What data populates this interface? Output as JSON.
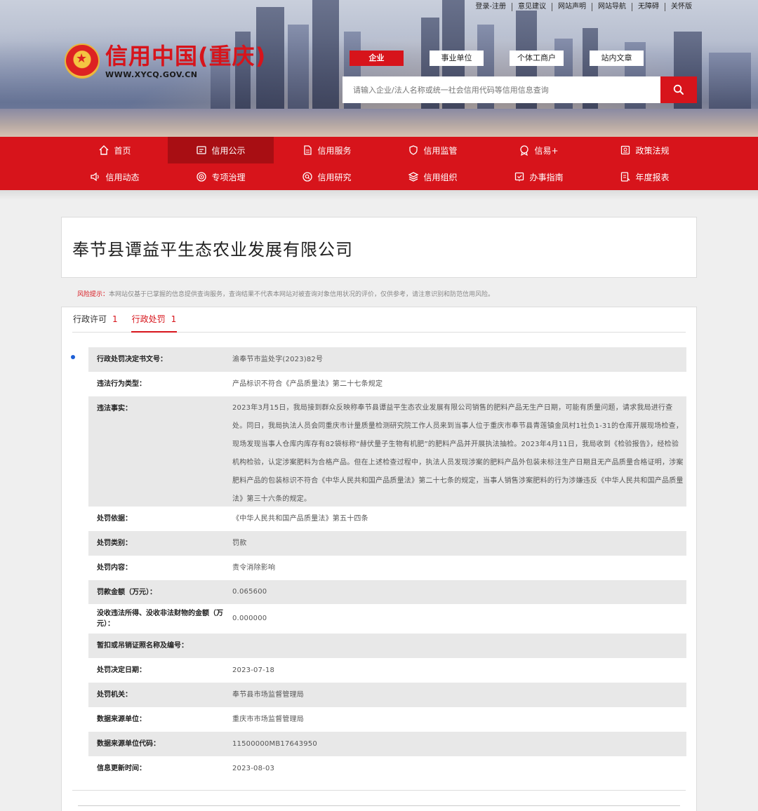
{
  "top_links": [
    "登录-注册",
    "意见建议",
    "网站声明",
    "网站导航",
    "无障碍",
    "关怀版"
  ],
  "site": {
    "title": "信用中国(重庆)",
    "url": "WWW.XYCQ.GOV.CN"
  },
  "search": {
    "tabs": [
      "企业",
      "事业单位",
      "个体工商户",
      "站内文章"
    ],
    "active_tab": "企业",
    "placeholder": "请输入企业/法人名称或统一社会信用代码等信用信息查询"
  },
  "nav": {
    "row1": [
      {
        "label": "首页",
        "icon": "home-icon"
      },
      {
        "label": "信用公示",
        "icon": "id-card-icon",
        "active": true
      },
      {
        "label": "信用服务",
        "icon": "document-icon"
      },
      {
        "label": "信用监管",
        "icon": "shield-icon"
      },
      {
        "label": "信易+",
        "icon": "badge-icon"
      },
      {
        "label": "政策法规",
        "icon": "law-icon"
      }
    ],
    "row2": [
      {
        "label": "信用动态",
        "icon": "speaker-icon"
      },
      {
        "label": "专项治理",
        "icon": "target-icon"
      },
      {
        "label": "信用研究",
        "icon": "research-icon"
      },
      {
        "label": "信用组织",
        "icon": "layers-icon"
      },
      {
        "label": "办事指南",
        "icon": "guide-icon"
      },
      {
        "label": "年度报表",
        "icon": "report-icon"
      }
    ]
  },
  "company": {
    "name": "奉节县谭益平生态农业发展有限公司"
  },
  "risk": {
    "label": "风险提示：",
    "text": "本网站仅基于已掌握的信息提供查询服务，查询结果不代表本网站对被查询对象信用状况的评价，仅供参考，请注意识别和防范信用风险。"
  },
  "tabs": [
    {
      "label": "行政许可",
      "count": "1"
    },
    {
      "label": "行政处罚",
      "count": "1",
      "active": true
    }
  ],
  "penalty": [
    {
      "k": "行政处罚决定书文号：",
      "v": "渝奉节市监处字(2023)82号"
    },
    {
      "k": "违法行为类型：",
      "v": "产品标识不符合《产品质量法》第二十七条规定"
    },
    {
      "k": "违法事实：",
      "v": "2023年3月15日，我局接到群众反映称奉节县谭益平生态农业发展有限公司销售的肥料产品无生产日期，可能有质量问题，请求我局进行查处。同日，我局执法人员会同重庆市计量质量检测研究院工作人员来到当事人位于重庆市奉节县青莲镇金凤村1社负1-31的仓库开展现场检查，现场发现当事人仓库内库存有82袋标称“赫伏量子生物有机肥”的肥料产品并开展执法抽检。2023年4月11日，我局收到《检验报告》，经检验机构检验，认定涉案肥料为合格产品。但在上述检查过程中，执法人员发现涉案的肥料产品外包装未标注生产日期且无产品质量合格证明，涉案肥料产品的包装标识不符合《中华人民共和国产品质量法》第二十七条的规定，当事人销售涉案肥料的行为涉嫌违反《中华人民共和国产品质量法》第三十六条的规定。"
    },
    {
      "k": "处罚依据：",
      "v": "《中华人民共和国产品质量法》第五十四条"
    },
    {
      "k": "处罚类别：",
      "v": "罚款"
    },
    {
      "k": "处罚内容：",
      "v": "责令消除影响"
    },
    {
      "k": "罚款金额（万元）：",
      "v": "0.065600"
    },
    {
      "k": "没收违法所得、没收非法财物的金额（万元）：",
      "v": "0.000000"
    },
    {
      "k": "暂扣或吊销证照名称及编号：",
      "v": ""
    },
    {
      "k": "处罚决定日期：",
      "v": "2023-07-18"
    },
    {
      "k": "处罚机关：",
      "v": "奉节县市场监督管理局"
    },
    {
      "k": "数据来源单位：",
      "v": "重庆市市场监督管理局"
    },
    {
      "k": "数据来源单位代码：",
      "v": "11500000MB17643950"
    },
    {
      "k": "信息更新时间：",
      "v": "2023-08-03"
    }
  ],
  "colors": {
    "brand_red": "#d7141b",
    "active_nav": "#a80e13"
  }
}
